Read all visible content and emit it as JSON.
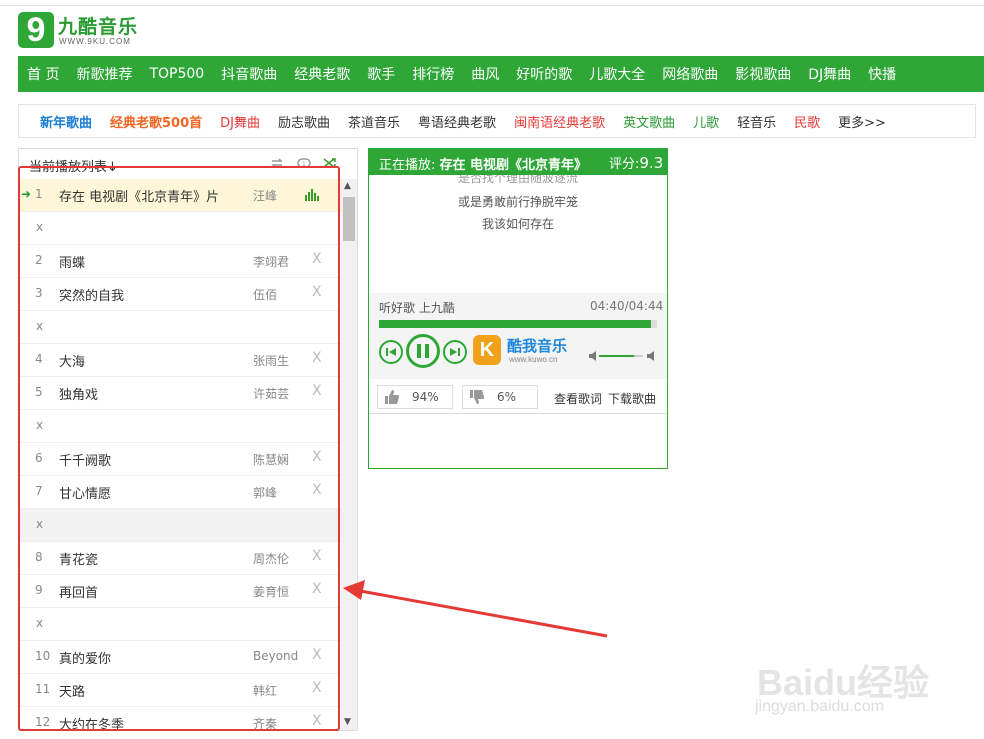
{
  "site": {
    "logo_mark": "9",
    "name": "九酷音乐",
    "url": "WWW.9KU.COM"
  },
  "nav": [
    "首 页",
    "新歌推荐",
    "TOP500",
    "抖音歌曲",
    "经典老歌",
    "歌手",
    "排行榜",
    "曲风",
    "好听的歌",
    "儿歌大全",
    "网络歌曲",
    "影视歌曲",
    "DJ舞曲",
    "快播"
  ],
  "subnav": [
    {
      "label": "新年歌曲",
      "color": "#1a7fd4",
      "bold": true
    },
    {
      "label": "经典老歌500首",
      "color": "#f26522",
      "bold": true
    },
    {
      "label": "DJ舞曲",
      "color": "#e53935",
      "bold": false
    },
    {
      "label": "励志歌曲",
      "color": "#333333",
      "bold": false
    },
    {
      "label": "茶道音乐",
      "color": "#333333",
      "bold": false
    },
    {
      "label": "粤语经典老歌",
      "color": "#333333",
      "bold": false
    },
    {
      "label": "闽南语经典老歌",
      "color": "#e53935",
      "bold": false
    },
    {
      "label": "英文歌曲",
      "color": "#2a9a33",
      "bold": false
    },
    {
      "label": "儿歌",
      "color": "#2a9a33",
      "bold": false
    },
    {
      "label": "轻音乐",
      "color": "#333333",
      "bold": false
    },
    {
      "label": "民歌",
      "color": "#e53935",
      "bold": false
    },
    {
      "label": "更多>>",
      "color": "#333333",
      "bold": false
    }
  ],
  "playlist": {
    "title": "当前播放列表↓",
    "rows": [
      {
        "type": "song",
        "num": "1",
        "title": "存在 电视剧《北京青年》片",
        "artist": "汪峰",
        "current": true
      },
      {
        "type": "sep",
        "label": "x"
      },
      {
        "type": "song",
        "num": "2",
        "title": "雨蝶",
        "artist": "李翊君",
        "del": "X"
      },
      {
        "type": "song",
        "num": "3",
        "title": "突然的自我",
        "artist": "伍佰",
        "del": "X"
      },
      {
        "type": "sep",
        "label": "x"
      },
      {
        "type": "song",
        "num": "4",
        "title": "大海",
        "artist": "张雨生",
        "del": "X"
      },
      {
        "type": "song",
        "num": "5",
        "title": "独角戏",
        "artist": "许茹芸",
        "del": "X"
      },
      {
        "type": "sep",
        "label": "x"
      },
      {
        "type": "song",
        "num": "6",
        "title": "千千阙歌",
        "artist": "陈慧娴",
        "del": "X"
      },
      {
        "type": "song",
        "num": "7",
        "title": "甘心情愿",
        "artist": "郭峰",
        "del": "X"
      },
      {
        "type": "sep",
        "label": "x",
        "hl": true
      },
      {
        "type": "song",
        "num": "8",
        "title": "青花瓷",
        "artist": "周杰伦",
        "del": "X"
      },
      {
        "type": "song",
        "num": "9",
        "title": "再回首",
        "artist": "姜育恒",
        "del": "X"
      },
      {
        "type": "sep",
        "label": "x"
      },
      {
        "type": "song",
        "num": "10",
        "title": "真的爱你",
        "artist": "Beyond",
        "del": "X"
      },
      {
        "type": "song",
        "num": "11",
        "title": "天路",
        "artist": "韩红",
        "del": "X"
      },
      {
        "type": "song",
        "num": "12",
        "title": "大约在冬季",
        "artist": "齐秦",
        "del": "X"
      }
    ]
  },
  "player": {
    "now_playing_label": "正在播放:",
    "now_playing_title": "存在 电视剧《北京青年》",
    "score_label": "评分:",
    "score_value": "9.3",
    "lyrics": [
      "是否找个理由随波逐流",
      "或是勇敢前行挣脱牢笼",
      "我该如何存在"
    ],
    "slogan": "听好歌 上九酷",
    "time": "04:40/04:44",
    "progress": 0.98,
    "volume": 0.8,
    "brand_name": "酷我音乐",
    "brand_url": "www.kuwo.cn",
    "brand_mark": "K",
    "like_pct": "94%",
    "dislike_pct": "6%",
    "view_lyrics": "查看歌词",
    "download": "下载歌曲"
  },
  "watermark": {
    "text": "Baidu经验",
    "url": "jingyan.baidu.com"
  },
  "colors": {
    "brand_green": "#2ea737",
    "annotation_red": "#e53935"
  }
}
